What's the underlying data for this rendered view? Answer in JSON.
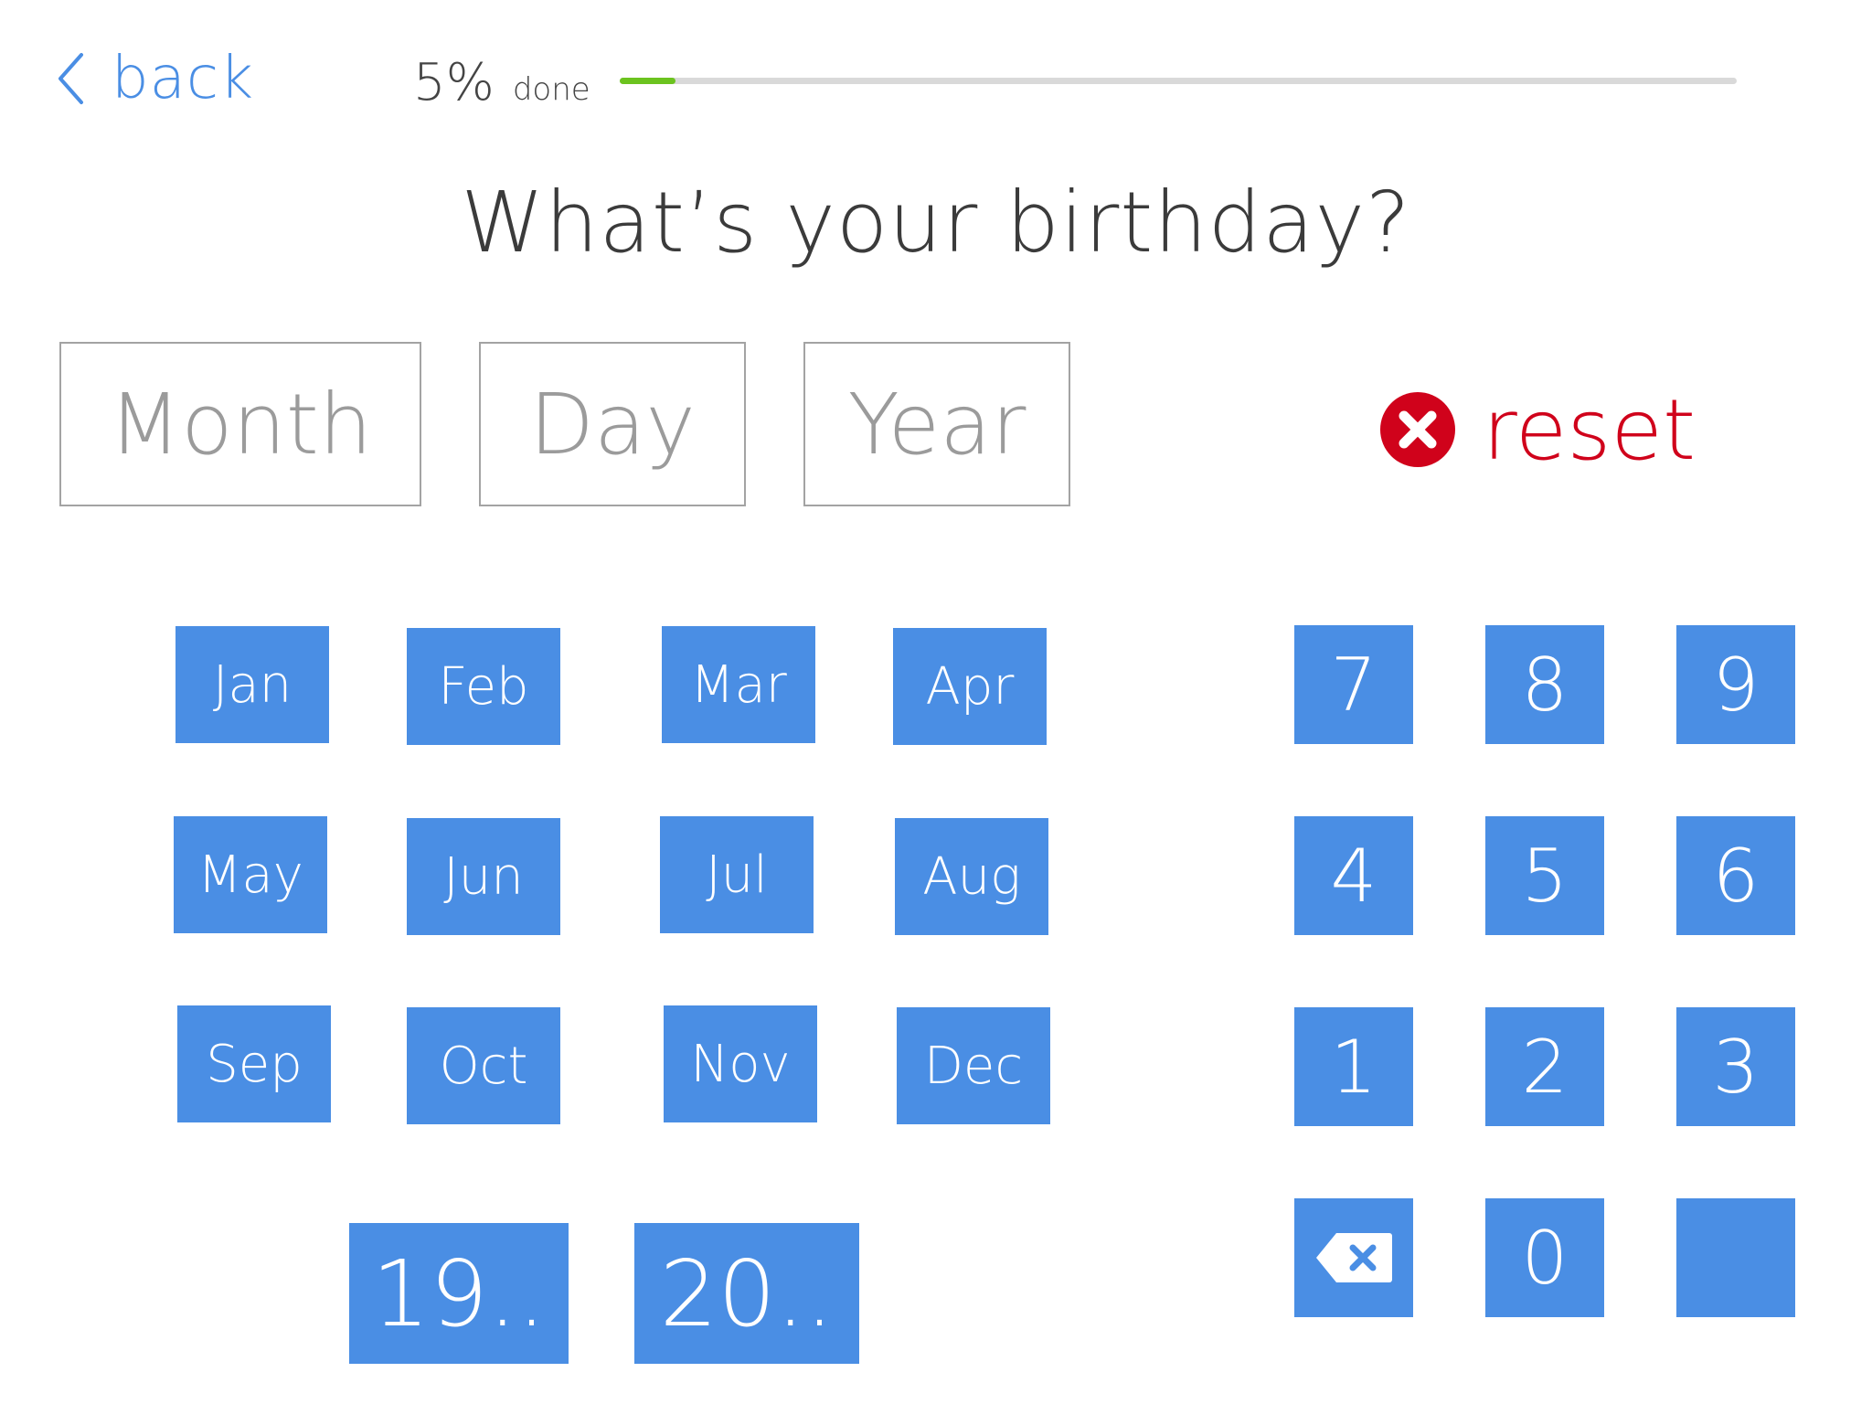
{
  "header": {
    "back_label": "back",
    "progress_percent": "5%",
    "progress_done": "done",
    "progress_fraction": 0.05
  },
  "question": "What’s your birthday?",
  "fields": {
    "month_placeholder": "Month",
    "day_placeholder": "Day",
    "year_placeholder": "Year"
  },
  "reset_label": "reset",
  "months": [
    "Jan",
    "Feb",
    "Mar",
    "Apr",
    "May",
    "Jun",
    "Jul",
    "Aug",
    "Sep",
    "Oct",
    "Nov",
    "Dec"
  ],
  "century": [
    "19..",
    "20.."
  ],
  "keypad": [
    "7",
    "8",
    "9",
    "4",
    "5",
    "6",
    "1",
    "2",
    "3",
    "",
    "0",
    ""
  ],
  "colors": {
    "accent": "#4a8ee4",
    "progress": "#6cc31f",
    "danger": "#d0021b"
  }
}
